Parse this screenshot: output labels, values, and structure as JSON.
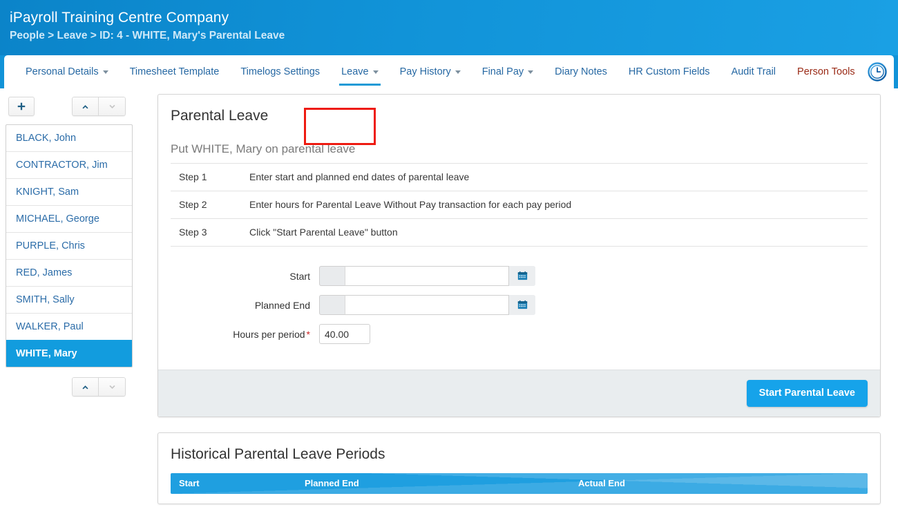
{
  "header": {
    "company_title": "iPayroll Training Centre Company",
    "breadcrumb": "People > Leave > ID: 4 - WHITE, Mary's Parental Leave",
    "brand_color": "#1193d8",
    "breadcrumb_color": "#cfe9f8"
  },
  "tabs": [
    {
      "label": "Personal Details",
      "has_caret": true,
      "active": false,
      "style": "normal"
    },
    {
      "label": "Timesheet Template",
      "has_caret": false,
      "active": false,
      "style": "normal"
    },
    {
      "label": "Timelogs Settings",
      "has_caret": false,
      "active": false,
      "style": "normal"
    },
    {
      "label": "Leave",
      "has_caret": true,
      "active": true,
      "style": "normal"
    },
    {
      "label": "Pay History",
      "has_caret": true,
      "active": false,
      "style": "normal"
    },
    {
      "label": "Final Pay",
      "has_caret": true,
      "active": false,
      "style": "normal"
    },
    {
      "label": "Diary Notes",
      "has_caret": false,
      "active": false,
      "style": "normal"
    },
    {
      "label": "HR Custom Fields",
      "has_caret": false,
      "active": false,
      "style": "normal"
    },
    {
      "label": "Audit Trail",
      "has_caret": false,
      "active": false,
      "style": "normal"
    },
    {
      "label": "Person Tools",
      "has_caret": false,
      "active": false,
      "style": "person-tools"
    }
  ],
  "tabbar": {
    "clock_icon": "clock-icon",
    "active_underline_color": "#1b9ad6",
    "person_tools_color": "#9a2a16",
    "highlight_box_color": "#ee1b11"
  },
  "sidebar": {
    "add_button_icon": "plus-icon",
    "nav_up_icon": "chevron-up-icon",
    "nav_down_icon": "chevron-down-icon",
    "people": [
      {
        "name": "BLACK, John",
        "selected": false
      },
      {
        "name": "CONTRACTOR, Jim",
        "selected": false
      },
      {
        "name": "KNIGHT, Sam",
        "selected": false
      },
      {
        "name": "MICHAEL, George",
        "selected": false
      },
      {
        "name": "PURPLE, Chris",
        "selected": false
      },
      {
        "name": "RED, James",
        "selected": false
      },
      {
        "name": "SMITH, Sally",
        "selected": false
      },
      {
        "name": "WALKER, Paul",
        "selected": false
      },
      {
        "name": "WHITE, Mary",
        "selected": true
      }
    ],
    "selected_bg": "#129cde"
  },
  "parental_leave_panel": {
    "title": "Parental Leave",
    "subtitle": "Put WHITE, Mary on parental leave",
    "steps": [
      {
        "label": "Step 1",
        "description": "Enter start and planned end dates of parental leave"
      },
      {
        "label": "Step 2",
        "description": "Enter hours for Parental Leave Without Pay transaction for each pay period"
      },
      {
        "label": "Step 3",
        "description": "Click \"Start Parental Leave\" button"
      }
    ],
    "form": {
      "start": {
        "label": "Start",
        "value": "",
        "placeholder": "",
        "calendar_icon": "calendar-icon"
      },
      "planned_end": {
        "label": "Planned End",
        "value": "",
        "placeholder": "",
        "calendar_icon": "calendar-icon"
      },
      "hours_per_period": {
        "label": "Hours per period",
        "required_marker": "*",
        "value": "40.00",
        "placeholder": ""
      }
    },
    "submit_label": "Start Parental Leave",
    "submit_color": "#16a3ea"
  },
  "historical_panel": {
    "title": "Historical Parental Leave Periods",
    "columns": [
      "Start",
      "Planned End",
      "Actual End"
    ],
    "rows": [],
    "header_color": "#1f9fe0"
  }
}
